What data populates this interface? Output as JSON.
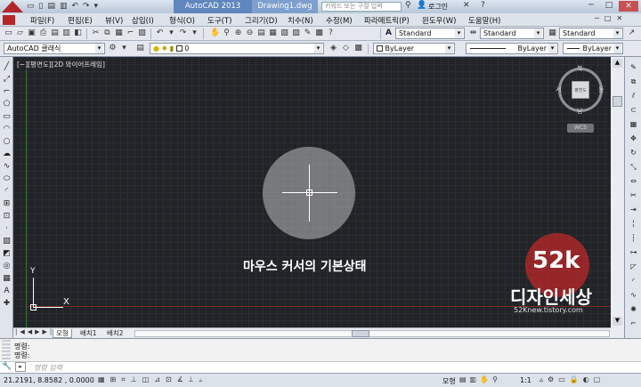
{
  "title": {
    "app": "AutoCAD 2013",
    "file": "Drawing1.dwg",
    "search_placeholder": "키워드 또는 구절 입력",
    "login": "로그인"
  },
  "menu": [
    "파일(F)",
    "편집(E)",
    "뷰(V)",
    "삽입(I)",
    "형식(O)",
    "도구(T)",
    "그리기(D)",
    "치수(N)",
    "수정(M)",
    "파라메트릭(P)",
    "윈도우(W)",
    "도움말(H)"
  ],
  "toolbar": {
    "text_style": "Standard",
    "dim_style": "Standard",
    "table_style": "Standard",
    "workspace": "AutoCAD 클래식",
    "layer": "0",
    "color": "ByLayer",
    "linetype": "ByLayer",
    "lineweight": "ByLayer"
  },
  "viewport": {
    "label": "[−][평면도][2D 와이어프레임]",
    "caption": "마우스 커서의 기본상태"
  },
  "viewcube": {
    "north": "북",
    "south": "남",
    "east": "동",
    "west": "서",
    "face": "평면도",
    "wcs": "WCS"
  },
  "watermark": {
    "big": "52k",
    "name": "디자인세상",
    "url": "52Knew.tistory.com"
  },
  "ucs": {
    "x": "X",
    "y": "Y"
  },
  "tabs": [
    "모형",
    "배치1",
    "배치2"
  ],
  "command": {
    "line1": "명령:",
    "line2": "명령:",
    "placeholder": "명령 입력"
  },
  "status": {
    "coords": "21.2191, 8.8582 , 0.0000",
    "model": "모형",
    "scale": "1:1"
  }
}
